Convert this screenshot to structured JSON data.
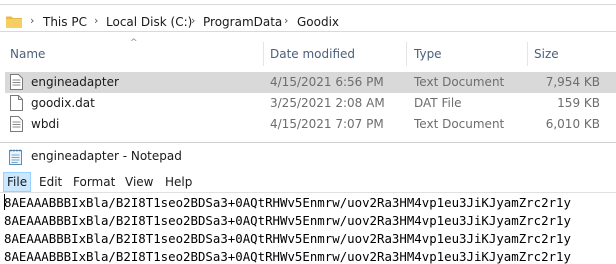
{
  "explorer": {
    "breadcrumb": [
      "This PC",
      "Local Disk (C:)",
      "ProgramData",
      "Goodix"
    ],
    "columns": {
      "name": "Name",
      "date_modified": "Date modified",
      "type": "Type",
      "size": "Size"
    },
    "files": [
      {
        "name": "engineadapter",
        "date": "4/15/2021 6:56 PM",
        "type": "Text Document",
        "size": "7,954 KB",
        "selected": true
      },
      {
        "name": "goodix.dat",
        "date": "3/25/2021 2:08 AM",
        "type": "DAT File",
        "size": "159 KB",
        "selected": false
      },
      {
        "name": "wbdi",
        "date": "4/15/2021 7:07 PM",
        "type": "Text Document",
        "size": "6,010 KB",
        "selected": false
      }
    ]
  },
  "notepad": {
    "title": "engineadapter - Notepad",
    "menu": [
      "File",
      "Edit",
      "Format",
      "View",
      "Help"
    ],
    "active_menu": "File",
    "lines": [
      "8AEAAABBBIxBla/B2I8T1seo2BDSa3+0AQtRHWv5Enmrw/uov2Ra3HM4vp1eu3JiKJyamZrc2r1y",
      "8AEAAABBBIxBla/B2I8T1seo2BDSa3+0AQtRHWv5Enmrw/uov2Ra3HM4vp1eu3JiKJyamZrc2r1y",
      "8AEAAABBBIxBla/B2I8T1seo2BDSa3+0AQtRHWv5Enmrw/uov2Ra3HM4vp1eu3JiKJyamZrc2r1y",
      "8AEAAABBBIxBla/B2I8T1seo2BDSa3+0AQtRHWv5Enmrw/uov2Ra3HM4vp1eu3JiKJyamZrc2r1y"
    ]
  }
}
